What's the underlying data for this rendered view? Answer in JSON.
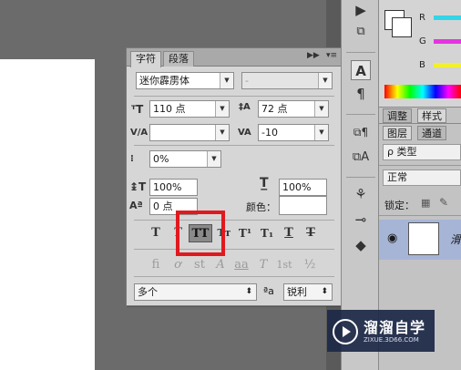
{
  "char_panel": {
    "tabs": [
      "字符",
      "段落"
    ],
    "font_family": "迷你霹雳体",
    "font_style": "-",
    "font_size": "110 点",
    "leading": "72 点",
    "kerning": "",
    "tracking": "-10",
    "scale_percent": "0%",
    "vertical_scale": "100%",
    "horizontal_scale": "100%",
    "baseline_shift": "0 点",
    "color_label": "颜色：",
    "style_buttons": [
      {
        "label": "T",
        "name": "faux-bold"
      },
      {
        "label": "T",
        "name": "faux-italic"
      },
      {
        "label": "TT",
        "name": "all-caps"
      },
      {
        "label": "Tт",
        "name": "small-caps"
      },
      {
        "label": "T¹",
        "name": "superscript"
      },
      {
        "label": "T₁",
        "name": "subscript"
      },
      {
        "label": "T",
        "name": "underline"
      },
      {
        "label": "T",
        "name": "strikethrough"
      }
    ],
    "opentype_buttons": [
      {
        "label": "fi",
        "name": "standard-ligatures"
      },
      {
        "label": "ơ",
        "name": "contextual-alternates"
      },
      {
        "label": "st",
        "name": "discretionary-ligatures"
      },
      {
        "label": "A",
        "name": "swash"
      },
      {
        "label": "aa",
        "name": "stylistic-alternates"
      },
      {
        "label": "T",
        "name": "titling-alternates"
      },
      {
        "label": "1st",
        "name": "ordinals"
      },
      {
        "label": "½",
        "name": "fractions"
      }
    ],
    "language": "多个",
    "aa_label": "ªa",
    "antialias": "锐利"
  },
  "color_panel": {
    "r_label": "R",
    "g_label": "G",
    "b_label": "B",
    "colors": {
      "r": "#33d6e8",
      "g": "#e535e0",
      "b": "#f2f02a"
    }
  },
  "right_panels": {
    "style_tabs": [
      "调整",
      "样式"
    ],
    "layer_tabs": [
      "图层",
      "通道"
    ],
    "filter_label": "ρ 类型",
    "blend_mode": "正常",
    "lock_label": "锁定：",
    "layer_name": "滑"
  },
  "watermark": {
    "title": "溜溜自学",
    "url": "ZIXUE.3D66.COM"
  }
}
